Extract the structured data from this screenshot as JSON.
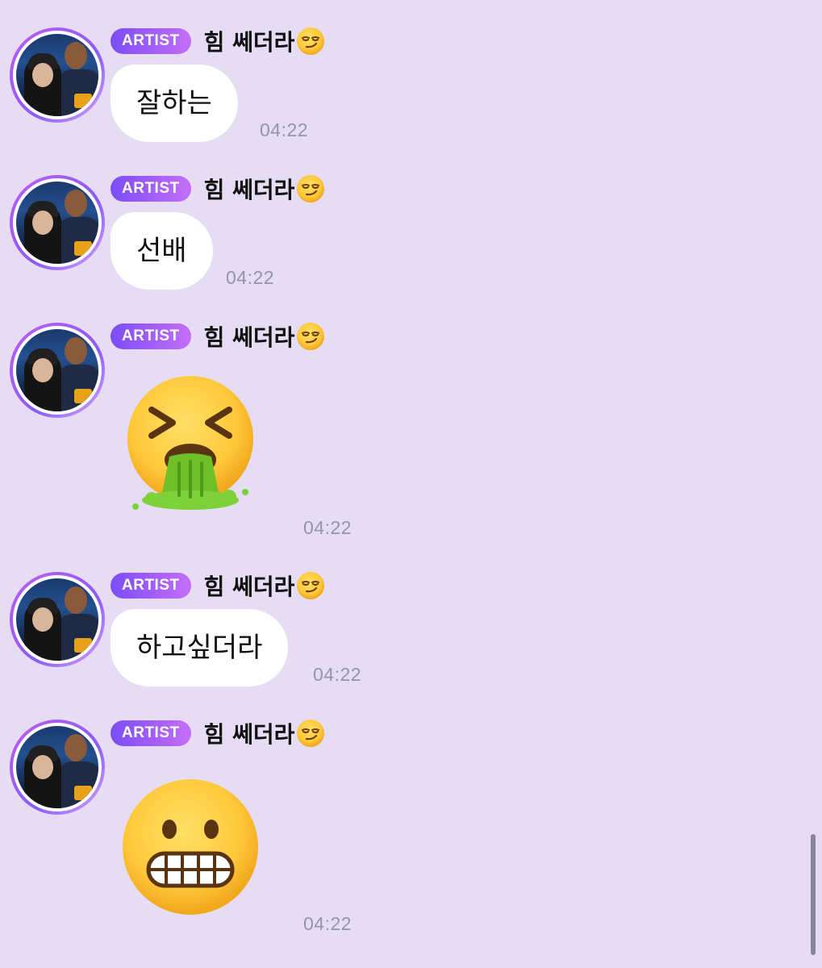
{
  "messages": [
    {
      "badge": "ARTIST",
      "sender": "힘 쎄더라",
      "sender_emoji": "smirking-face",
      "type": "text",
      "text": "잘하는",
      "time": "04:22"
    },
    {
      "badge": "ARTIST",
      "sender": "힘 쎄더라",
      "sender_emoji": "smirking-face",
      "type": "text",
      "text": "선배",
      "time": "04:22"
    },
    {
      "badge": "ARTIST",
      "sender": "힘 쎄더라",
      "sender_emoji": "smirking-face",
      "type": "emoji",
      "emoji": "vomiting-face",
      "time": "04:22"
    },
    {
      "badge": "ARTIST",
      "sender": "힘 쎄더라",
      "sender_emoji": "smirking-face",
      "type": "text",
      "text": "하고싶더라",
      "time": "04:22"
    },
    {
      "badge": "ARTIST",
      "sender": "힘 쎄더라",
      "sender_emoji": "smirking-face",
      "type": "emoji",
      "emoji": "grimacing-face",
      "time": "04:22"
    }
  ],
  "colors": {
    "background": "#e6dcf4",
    "badge_gradient_start": "#7b4df7",
    "badge_gradient_end": "#c56ef9",
    "bubble": "#ffffff",
    "timestamp": "#9a92a6"
  }
}
